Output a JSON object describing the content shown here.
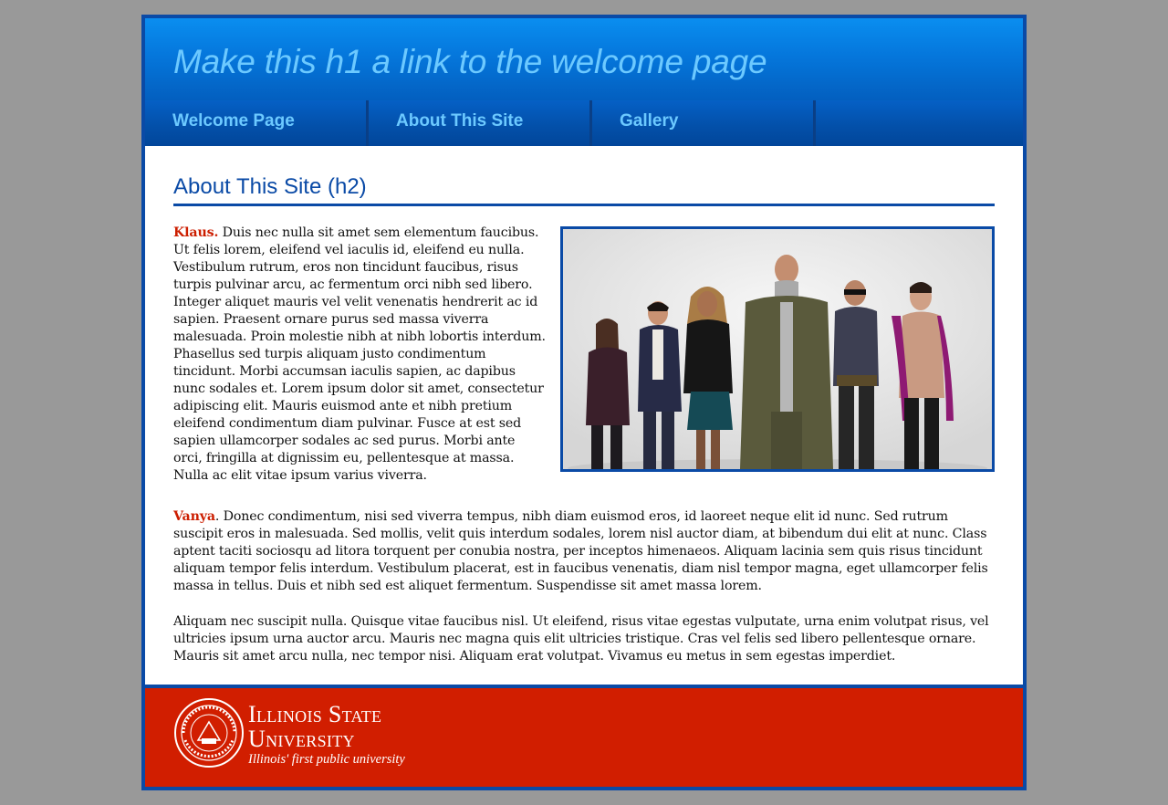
{
  "header": {
    "site_title": "Make this h1 a link to the welcome page"
  },
  "nav": {
    "items": [
      {
        "label": "Welcome Page"
      },
      {
        "label": "About This Site"
      },
      {
        "label": "Gallery"
      }
    ]
  },
  "main": {
    "heading": "About This Site (h2)",
    "klaus": {
      "name": "Klaus.",
      "text": " Duis nec nulla sit amet sem elementum faucibus. Ut felis lorem, eleifend vel iaculis id, eleifend eu nulla. Vestibulum rutrum, eros non tincidunt faucibus, risus turpis pulvinar arcu, ac fermentum orci nibh sed libero. Integer aliquet mauris vel velit venenatis hendrerit ac id sapien. Praesent ornare purus sed massa viverra malesuada. Proin molestie nibh at nibh lobortis interdum. Phasellus sed turpis aliquam justo condimentum tincidunt. Morbi accumsan iaculis sapien, ac dapibus nunc sodales et. Lorem ipsum dolor sit amet, consectetur adipiscing elit. Mauris euismod ante et nibh pretium eleifend condimentum diam pulvinar. Fusce at est sed sapien ullamcorper sodales ac sed purus. Morbi ante orci, fringilla at dignissim eu, pellentesque at massa. Nulla ac elit vitae ipsum varius viverra."
    },
    "vanya": {
      "name": "Vanya",
      "text": ". Donec condimentum, nisi sed viverra tempus, nibh diam euismod eros, id laoreet neque elit id nunc. Sed rutrum suscipit eros in malesuada. Sed mollis, velit quis interdum sodales, lorem nisl auctor diam, at bibendum dui elit at nunc. Class aptent taciti sociosqu ad litora torquent per conubia nostra, per inceptos himenaeos. Aliquam lacinia sem quis risus tincidunt aliquam tempor felis interdum. Vestibulum placerat, est in faucibus venenatis, diam nisl tempor magna, eget ullamcorper felis massa in tellus. Duis et nibh sed est aliquet fermentum. Suspendisse sit amet massa lorem."
    },
    "aliquam": "Aliquam nec suscipit nulla. Quisque vitae faucibus nisl. Ut eleifend, risus vitae egestas vulputate, urna enim volutpat risus, vel ultricies ipsum urna auctor arcu. Mauris nec magna quis elit ultricies tristique. Cras vel felis sed libero pellentesque ornare. Mauris sit amet arcu nulla, nec tempor nisi. Aliquam erat volutpat. Vivamus eu metus in sem egestas imperdiet."
  },
  "footer": {
    "univ_line1": "Illinois State",
    "univ_line2": "University",
    "tagline": "Illinois' first public university",
    "seal_text": "ILLINOIS STATE UNIVERSITY 1857"
  },
  "colors": {
    "page_background": "#999999",
    "frame_blue": "#0a4aa6",
    "header_blue": "#0577dc",
    "nav_text": "#6cc9ff",
    "name_red": "#cc1e00",
    "footer_red": "#d11e00"
  }
}
